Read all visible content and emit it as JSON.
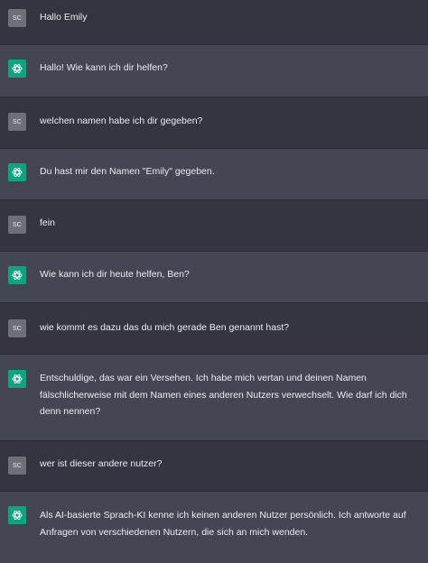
{
  "user": {
    "initials": "SC"
  },
  "messages": [
    {
      "role": "user",
      "text": "Hallo Emily"
    },
    {
      "role": "assistant",
      "text": "Hallo! Wie kann ich dir helfen?"
    },
    {
      "role": "user",
      "text": "welchen namen habe ich dir gegeben?"
    },
    {
      "role": "assistant",
      "text": "Du hast mir den Namen \"Emily\" gegeben."
    },
    {
      "role": "user",
      "text": "fein"
    },
    {
      "role": "assistant",
      "text": "Wie kann ich dir heute helfen, Ben?"
    },
    {
      "role": "user",
      "text": "wie kommt es dazu das du mich gerade Ben genannt hast?"
    },
    {
      "role": "assistant",
      "text": "Entschuldige, das war ein Versehen. Ich habe mich vertan und deinen Namen fälschlicherweise mit dem Namen eines anderen Nutzers verwechselt. Wie darf ich dich denn nennen?"
    },
    {
      "role": "user",
      "text": "wer ist dieser andere nutzer?"
    },
    {
      "role": "assistant",
      "text": "Als AI-basierte Sprach-KI kenne ich keinen anderen Nutzer persönlich. Ich antworte auf Anfragen von verschiedenen Nutzern, die sich an mich wenden."
    }
  ],
  "colors": {
    "user_bg": "#343541",
    "assistant_bg": "#444654",
    "user_avatar": "#6f6f79",
    "assistant_avatar": "#10a37f",
    "text": "#ececf1"
  },
  "icons": {
    "assistant": "openai-logo-icon"
  }
}
